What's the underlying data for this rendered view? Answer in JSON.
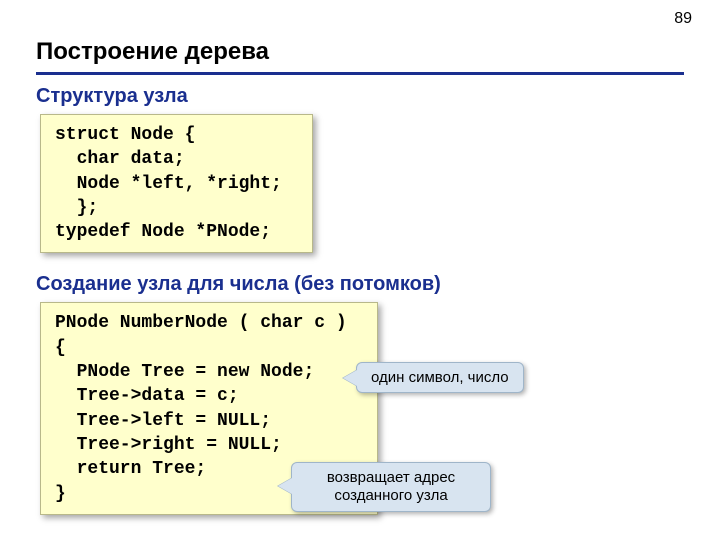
{
  "page_number": "89",
  "title": "Построение дерева",
  "section1": {
    "heading": "Структура узла",
    "code": "struct Node {\n  char data;\n  Node *left, *right;\n  };\ntypedef Node *PNode;"
  },
  "section2": {
    "heading": "Создание узла для числа (без потомков)",
    "code": "PNode NumberNode ( char c )\n{\n  PNode Tree = new Node;\n  Tree->data = c;\n  Tree->left = NULL;\n  Tree->right = NULL;\n  return Tree;\n}"
  },
  "callouts": {
    "c1": "один символ, число",
    "c2": "возвращает адрес созданного узла"
  }
}
